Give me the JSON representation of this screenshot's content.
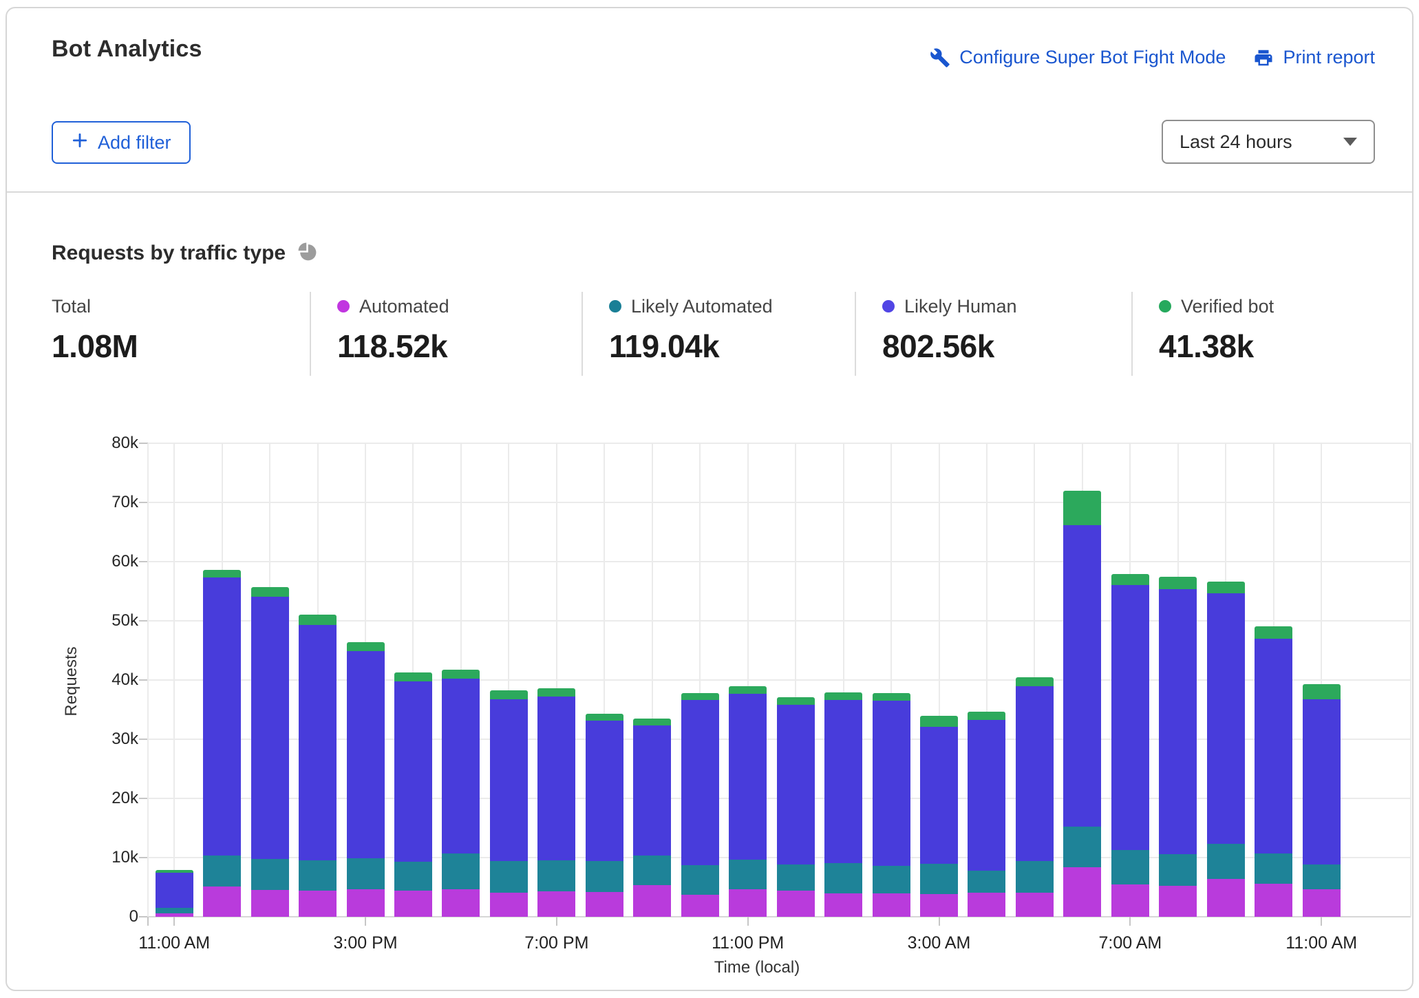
{
  "header": {
    "title": "Bot Analytics",
    "configure_link": "Configure Super Bot Fight Mode",
    "print_link": "Print report",
    "add_filter_label": "Add filter",
    "time_range": "Last 24 hours"
  },
  "section": {
    "title": "Requests by traffic type"
  },
  "stats": [
    {
      "label": "Total",
      "value": "1.08M",
      "dot_color": null
    },
    {
      "label": "Automated",
      "value": "118.52k",
      "dot_color": "#c136e0"
    },
    {
      "label": "Likely Automated",
      "value": "119.04k",
      "dot_color": "#1a7f96"
    },
    {
      "label": "Likely Human",
      "value": "802.56k",
      "dot_color": "#5145e5"
    },
    {
      "label": "Verified bot",
      "value": "41.38k",
      "dot_color": "#26a95d"
    }
  ],
  "colors": {
    "link_blue": "#1a56cf",
    "button_blue": "#2060d8",
    "divider_gray": "#d9d9d9"
  },
  "chart_data": {
    "type": "bar",
    "stacked": true,
    "title": "Requests by traffic type",
    "xlabel": "Time (local)",
    "ylabel": "Requests",
    "ylim": [
      0,
      80000
    ],
    "grid": true,
    "legend_position": "top-stats-row",
    "yticks": [
      "0",
      "10k",
      "20k",
      "30k",
      "40k",
      "50k",
      "60k",
      "70k",
      "80k"
    ],
    "categories": [
      "11:00 AM",
      "12:00 PM",
      "1:00 PM",
      "2:00 PM",
      "3:00 PM",
      "4:00 PM",
      "5:00 PM",
      "6:00 PM",
      "7:00 PM",
      "8:00 PM",
      "9:00 PM",
      "10:00 PM",
      "11:00 PM",
      "12:00 AM",
      "1:00 AM",
      "2:00 AM",
      "3:00 AM",
      "4:00 AM",
      "5:00 AM",
      "6:00 AM",
      "7:00 AM",
      "8:00 AM",
      "9:00 AM",
      "10:00 AM",
      "11:00 AM"
    ],
    "x_tick_labels": [
      {
        "i": 0,
        "label": "11:00 AM"
      },
      {
        "i": 4,
        "label": "3:00 PM"
      },
      {
        "i": 8,
        "label": "7:00 PM"
      },
      {
        "i": 12,
        "label": "11:00 PM"
      },
      {
        "i": 16,
        "label": "3:00 AM"
      },
      {
        "i": 20,
        "label": "7:00 AM"
      },
      {
        "i": 24,
        "label": "11:00 AM"
      }
    ],
    "series": [
      {
        "name": "Automated",
        "color": "#b93bdc",
        "values": [
          600,
          5100,
          4500,
          4400,
          4700,
          4400,
          4700,
          4100,
          4300,
          4200,
          5300,
          3700,
          4600,
          4400,
          4000,
          4000,
          3800,
          4100,
          4100,
          8400,
          5500,
          5200,
          6400,
          5600,
          4600
        ]
      },
      {
        "name": "Likely Automated",
        "color": "#1e8398",
        "values": [
          900,
          5300,
          5300,
          5100,
          5200,
          4900,
          6000,
          5300,
          5200,
          5200,
          5100,
          5000,
          5000,
          4400,
          5100,
          4600,
          5100,
          3700,
          5300,
          6800,
          5800,
          5400,
          5900,
          5100,
          4200
        ]
      },
      {
        "name": "Likely Human",
        "color": "#483cdb",
        "values": [
          6000,
          46900,
          44300,
          39800,
          35000,
          30500,
          29500,
          27400,
          27700,
          23700,
          21900,
          27900,
          28100,
          27000,
          27500,
          27900,
          23200,
          25500,
          29600,
          51000,
          44700,
          44800,
          42400,
          36300,
          28000
        ]
      },
      {
        "name": "Verified bot",
        "color": "#2ca95c",
        "values": [
          400,
          1300,
          1600,
          1700,
          1500,
          1500,
          1600,
          1500,
          1400,
          1200,
          1200,
          1200,
          1200,
          1300,
          1300,
          1300,
          1900,
          1400,
          1500,
          5800,
          1900,
          2000,
          1900,
          2100,
          2500
        ]
      }
    ]
  }
}
